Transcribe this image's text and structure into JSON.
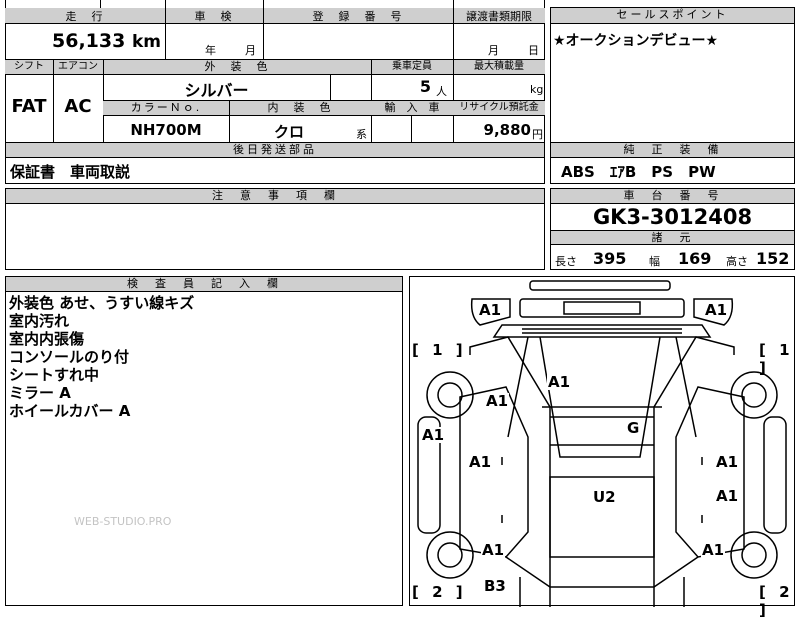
{
  "mileage": {
    "header": "走　行",
    "value": "56,133",
    "unit": "km"
  },
  "inspection": {
    "header": "車　検",
    "year_label": "年",
    "month_label": "月"
  },
  "registration": {
    "header": "登　録　番　号"
  },
  "transfer_deadline": {
    "header": "譲渡書類期限",
    "month_label": "月",
    "day_label": "日"
  },
  "sales_point": {
    "header": "セールスポイント",
    "text": "★オークションデビュー★"
  },
  "shift": {
    "header": "シフト",
    "value": "FAT"
  },
  "aircon": {
    "header": "エアコン",
    "value": "AC"
  },
  "exterior_color": {
    "header": "外　装　色",
    "value": "シルバー"
  },
  "capacity": {
    "header": "乗車定員",
    "value": "5",
    "unit": "人"
  },
  "max_load": {
    "header": "最大積載量",
    "unit": "kg"
  },
  "color_no": {
    "header": "カラーＮｏ.",
    "value": "NH700M"
  },
  "interior_color": {
    "header": "内　装　色",
    "value": "クロ",
    "suffix": "系"
  },
  "import_car": {
    "header": "輸　入　車"
  },
  "recycle": {
    "header": "リサイクル預託金",
    "value": "9,880",
    "unit": "円"
  },
  "later_parts": {
    "header": "後日発送部品",
    "text": "保証書　車両取説"
  },
  "standard_equipment": {
    "header": "純　正　装　備",
    "text": "ABS　ｴｱB　PS　PW"
  },
  "notes": {
    "header": "注　意　事　項　欄"
  },
  "chassis": {
    "header": "車　台　番　号",
    "value": "GK3-3012408"
  },
  "specs": {
    "header": "諸　元",
    "length_label": "長さ",
    "length": "395",
    "width_label": "幅",
    "width": "169",
    "height_label": "高さ",
    "height": "152"
  },
  "inspector": {
    "header": "検　査　員　記　入　欄",
    "lines": [
      "外装色 あせ、うすい線キズ",
      "室内汚れ",
      "室内内張傷",
      "コンソールのり付",
      "シートすれ中",
      "ミラー A",
      "ホイールカバー A"
    ]
  },
  "watermark": "WEB-STUDIO.PRO",
  "diagram": {
    "zones": [
      {
        "id": "front-left-corner",
        "text": "A1"
      },
      {
        "id": "front-right-corner",
        "text": "A1"
      },
      {
        "id": "windshield",
        "text": "A1"
      },
      {
        "id": "left-front-fender",
        "text": "A1"
      },
      {
        "id": "left-front-bumper-side",
        "text": "A1"
      },
      {
        "id": "glass-roof",
        "text": "G"
      },
      {
        "id": "left-front-door",
        "text": "A1"
      },
      {
        "id": "right-front-door",
        "text": "A1"
      },
      {
        "id": "roof",
        "text": "U2"
      },
      {
        "id": "right-rear-door",
        "text": "A1"
      },
      {
        "id": "left-rear-fender",
        "text": "A1"
      },
      {
        "id": "right-rear-fender",
        "text": "A1"
      },
      {
        "id": "rear",
        "text": "B3"
      }
    ],
    "brackets": [
      {
        "id": "bracket-top-left",
        "text": "[ 1 ]"
      },
      {
        "id": "bracket-top-right",
        "text": "[ 1 ]"
      },
      {
        "id": "bracket-bottom-left",
        "text": "[ 2 ]"
      },
      {
        "id": "bracket-bottom-right",
        "text": "[ 2 ]"
      }
    ]
  }
}
